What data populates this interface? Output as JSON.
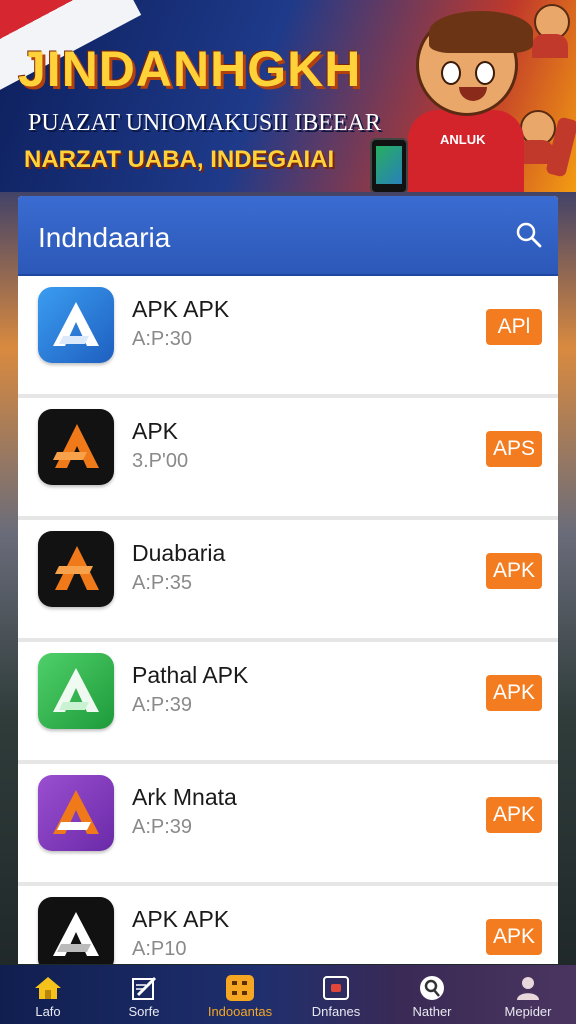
{
  "banner": {
    "title": "JINDANHGKH",
    "subtitle_1": "PUAZAT UNIOMAKUSII IBEEAR",
    "subtitle_2": "NARZAT UABA, INDEGAIAI",
    "mascot_shirt": "ANLUK"
  },
  "header": {
    "title": "Indndaaria",
    "search_icon": "search-icon"
  },
  "apps": [
    {
      "name": "APK APK",
      "size": "A:P:30",
      "button": "APl",
      "icon_color": "#2a7fd4",
      "icon_style": "blue"
    },
    {
      "name": "APK",
      "size": "3.P'00",
      "button": "APS",
      "icon_color": "#f07a1a",
      "icon_style": "black-orange"
    },
    {
      "name": "Duabaria",
      "size": "A:P:35",
      "button": "APK",
      "icon_color": "#f07a1a",
      "icon_style": "black-orange"
    },
    {
      "name": "Pathal APK",
      "size": "A:P:39",
      "button": "APK",
      "icon_color": "#2fb24a",
      "icon_style": "green"
    },
    {
      "name": "Ark Mnata",
      "size": "A:P:39",
      "button": "APK",
      "icon_color": "#7b3fb8",
      "icon_style": "purple-orange"
    },
    {
      "name": "APK APK",
      "size": "A:P10",
      "button": "APK",
      "icon_color": "#ffffff",
      "icon_style": "black-white"
    }
  ],
  "nav": [
    {
      "label": "Lafo",
      "icon": "home-icon",
      "active": false
    },
    {
      "label": "Sorfe",
      "icon": "edit-icon",
      "active": false
    },
    {
      "label": "Indooantas",
      "icon": "grid-icon",
      "active": true
    },
    {
      "label": "Dnfanes",
      "icon": "tv-icon",
      "active": false
    },
    {
      "label": "Nather",
      "icon": "search-icon",
      "active": false
    },
    {
      "label": "Mepider",
      "icon": "profile-icon",
      "active": false
    }
  ],
  "colors": {
    "accent_orange": "#f47c20",
    "header_blue": "#2c58b8",
    "nav_active": "#f5a623"
  }
}
